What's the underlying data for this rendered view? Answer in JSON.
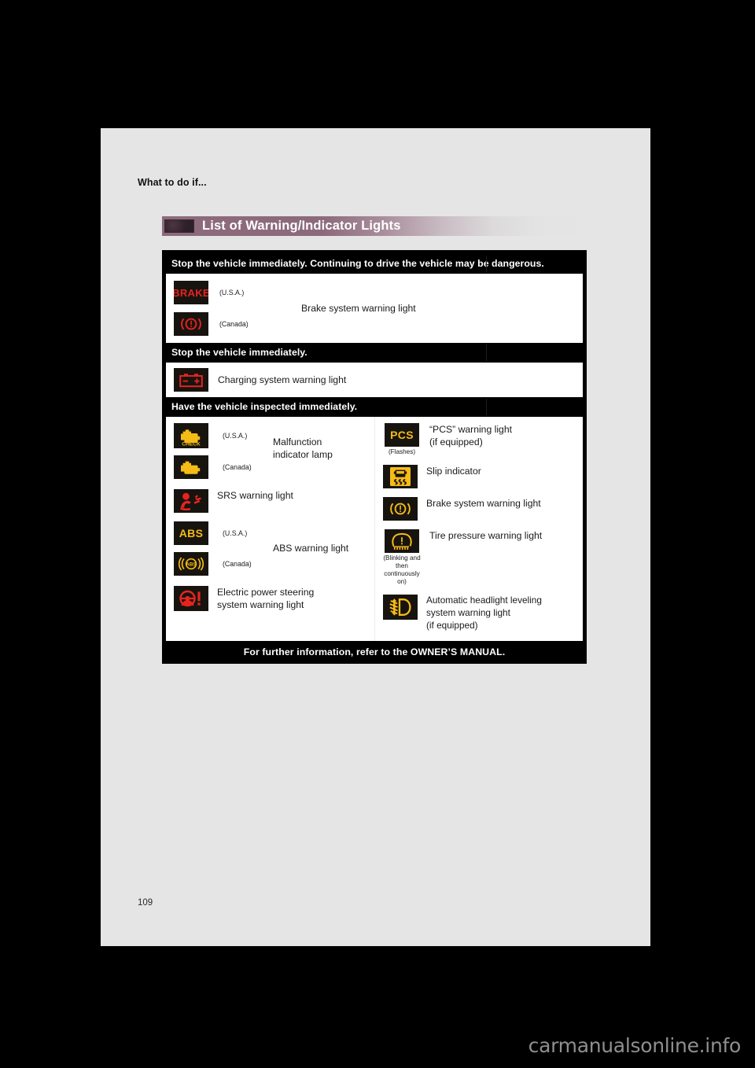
{
  "document": {
    "breadcrumb": "What to do if...",
    "section_title": "List of Warning/Indicator Lights",
    "page_number": "109",
    "watermark": "carmanualsonline.info"
  },
  "colors": {
    "title_bar_accent": "#8c6a7c",
    "tile_background": "#17140f",
    "warning_red": "#e8231f",
    "warning_amber": "#f5bb17",
    "page_background": "#e5e5e5",
    "table_background": "#000000"
  },
  "table": {
    "sections": [
      {
        "heading": "Stop the vehicle immediately. Continuing to drive the vehicle may be dangerous.",
        "layout": "stacked-single",
        "items": [
          {
            "label": "Brake system warning light",
            "variants": [
              {
                "icon": "brake-text-icon",
                "icon_text": "BRAKE",
                "color": "#e8231f",
                "locale": "(U.S.A.)"
              },
              {
                "icon": "brake-circle-icon",
                "color": "#e8231f",
                "locale": "(Canada)"
              }
            ]
          }
        ]
      },
      {
        "heading": "Stop the vehicle immediately.",
        "layout": "single",
        "items": [
          {
            "label": "Charging system warning light",
            "variants": [
              {
                "icon": "battery-icon",
                "color": "#e8231f",
                "locale": ""
              }
            ]
          }
        ]
      },
      {
        "heading": "Have the vehicle inspected immediately.",
        "layout": "two-column",
        "left_items": [
          {
            "label": "Malfunction indicator lamp",
            "label_line1": "Malfunction",
            "label_line2": "indicator lamp",
            "variants": [
              {
                "icon": "check-engine-check-icon",
                "icon_text": "CHECK",
                "color": "#f5bb17",
                "locale": "(U.S.A.)"
              },
              {
                "icon": "check-engine-icon",
                "color": "#f5bb17",
                "locale": "(Canada)"
              }
            ]
          },
          {
            "label": "SRS warning light",
            "variants": [
              {
                "icon": "srs-airbag-icon",
                "color": "#e8231f",
                "locale": ""
              }
            ]
          },
          {
            "label": "ABS warning light",
            "variants": [
              {
                "icon": "abs-text-icon",
                "icon_text": "ABS",
                "color": "#f5bb17",
                "locale": "(U.S.A.)"
              },
              {
                "icon": "abs-circle-icon",
                "icon_text": "ABS",
                "color": "#f5bb17",
                "locale": "(Canada)"
              }
            ]
          },
          {
            "label": "Electric power steering system warning light",
            "label_line1": "Electric power steering",
            "label_line2": "system warning light",
            "variants": [
              {
                "icon": "electric-power-steering-icon",
                "color": "#e8231f",
                "locale": ""
              }
            ]
          }
        ],
        "right_items": [
          {
            "label": "“PCS” warning light (if equipped)",
            "label_line1": "“PCS” warning light",
            "label_line2": "(if equipped)",
            "variants": [
              {
                "icon": "pcs-text-icon",
                "icon_text": "PCS",
                "color": "#f5bb17",
                "note": "(Flashes)"
              }
            ]
          },
          {
            "label": "Slip indicator",
            "variants": [
              {
                "icon": "slip-indicator-icon",
                "color": "#f5bb17",
                "note": ""
              }
            ]
          },
          {
            "label": "Brake system warning light",
            "variants": [
              {
                "icon": "brake-circle-icon",
                "color": "#f5bb17",
                "note": ""
              }
            ]
          },
          {
            "label": "Tire pressure warning light",
            "variants": [
              {
                "icon": "tire-pressure-icon",
                "color": "#f5bb17",
                "note": "(Blinking and then continuously on)"
              }
            ]
          },
          {
            "label": "Automatic headlight leveling system warning light (if equipped)",
            "label_line1": "Automatic headlight leveling",
            "label_line2": "system warning light",
            "label_line3": "(if equipped)",
            "variants": [
              {
                "icon": "headlight-leveling-icon",
                "color": "#f5bb17",
                "note": ""
              }
            ]
          }
        ]
      }
    ],
    "footer": "For further information, refer to the OWNER’S MANUAL."
  }
}
